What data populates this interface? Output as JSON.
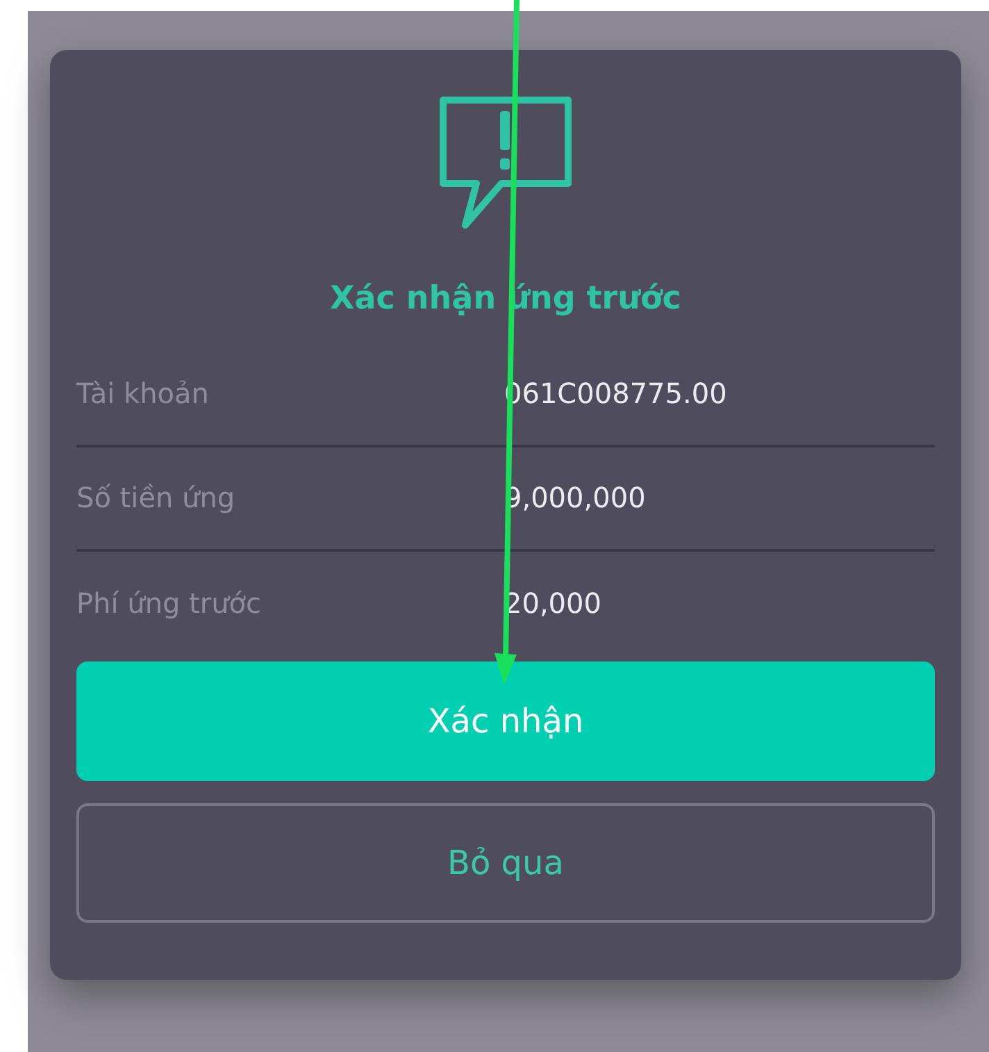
{
  "dialog": {
    "title": "Xác nhận ứng trước",
    "rows": [
      {
        "label": "Tài khoản",
        "value": "061C008775.00"
      },
      {
        "label": "Số tiền ứng",
        "value": "9,000,000"
      },
      {
        "label": "Phí ứng trước",
        "value": "20,000"
      }
    ],
    "buttons": [
      {
        "label": "Xác nhận",
        "kind": "primary"
      },
      {
        "label": "Bỏ qua",
        "kind": "secondary"
      }
    ]
  }
}
